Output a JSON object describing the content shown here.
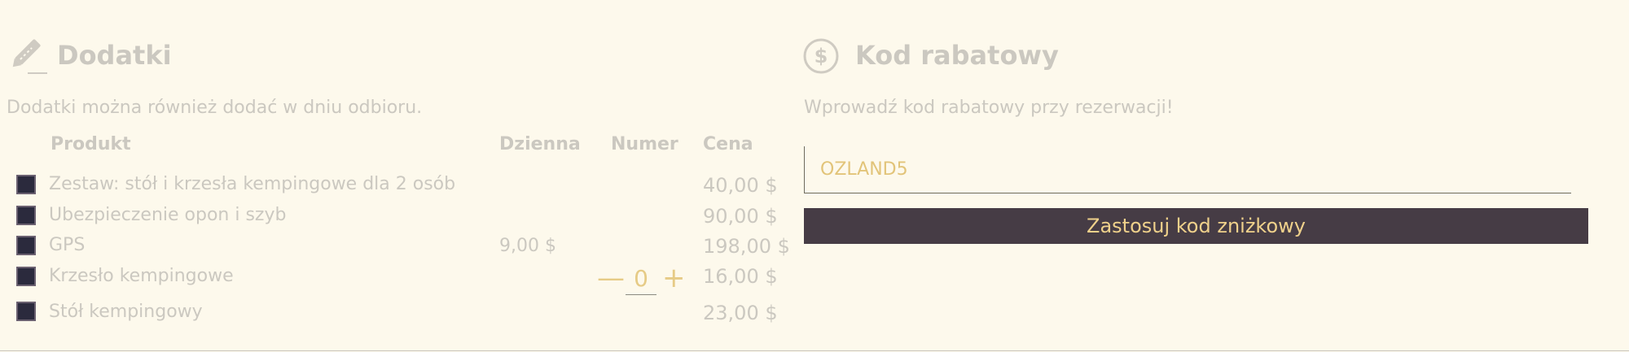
{
  "addons": {
    "icon": "pencil-icon",
    "title": "Dodatki",
    "subtitle": "Dodatki można również dodać w dniu odbioru.",
    "columns": {
      "product": "Produkt",
      "daily": "Dzienna",
      "number": "Numer",
      "price": "Cena"
    },
    "rows": [
      {
        "label": "Zestaw: stół i krzesła kempingowe dla 2 osób",
        "daily": "",
        "price": "40,00 $"
      },
      {
        "label": "Ubezpieczenie opon i szyb",
        "daily": "",
        "price": "90,00 $"
      },
      {
        "label": "GPS",
        "daily": "9,00 $",
        "price": "198,00 $"
      },
      {
        "label": "Krzesło kempingowe",
        "daily": "",
        "price": "16,00 $",
        "qty": "0",
        "minus": "—",
        "plus": "+"
      },
      {
        "label": "Stół kempingowy",
        "daily": "",
        "price": "23,00 $"
      }
    ]
  },
  "coupon": {
    "icon": "dollar-circle-icon",
    "title": "Kod rabatowy",
    "subtitle": "Wprowadź kod rabatowy przy rezerwacji!",
    "value": "OZLAND5",
    "apply_label": "Zastosuj kod zniżkowy"
  },
  "colors": {
    "background": "#fdf9ec",
    "muted_text": "#cbc8c0",
    "accent": "#e6cb86",
    "button_bg": "#463c45",
    "checkbox": "#2b2a3d"
  }
}
